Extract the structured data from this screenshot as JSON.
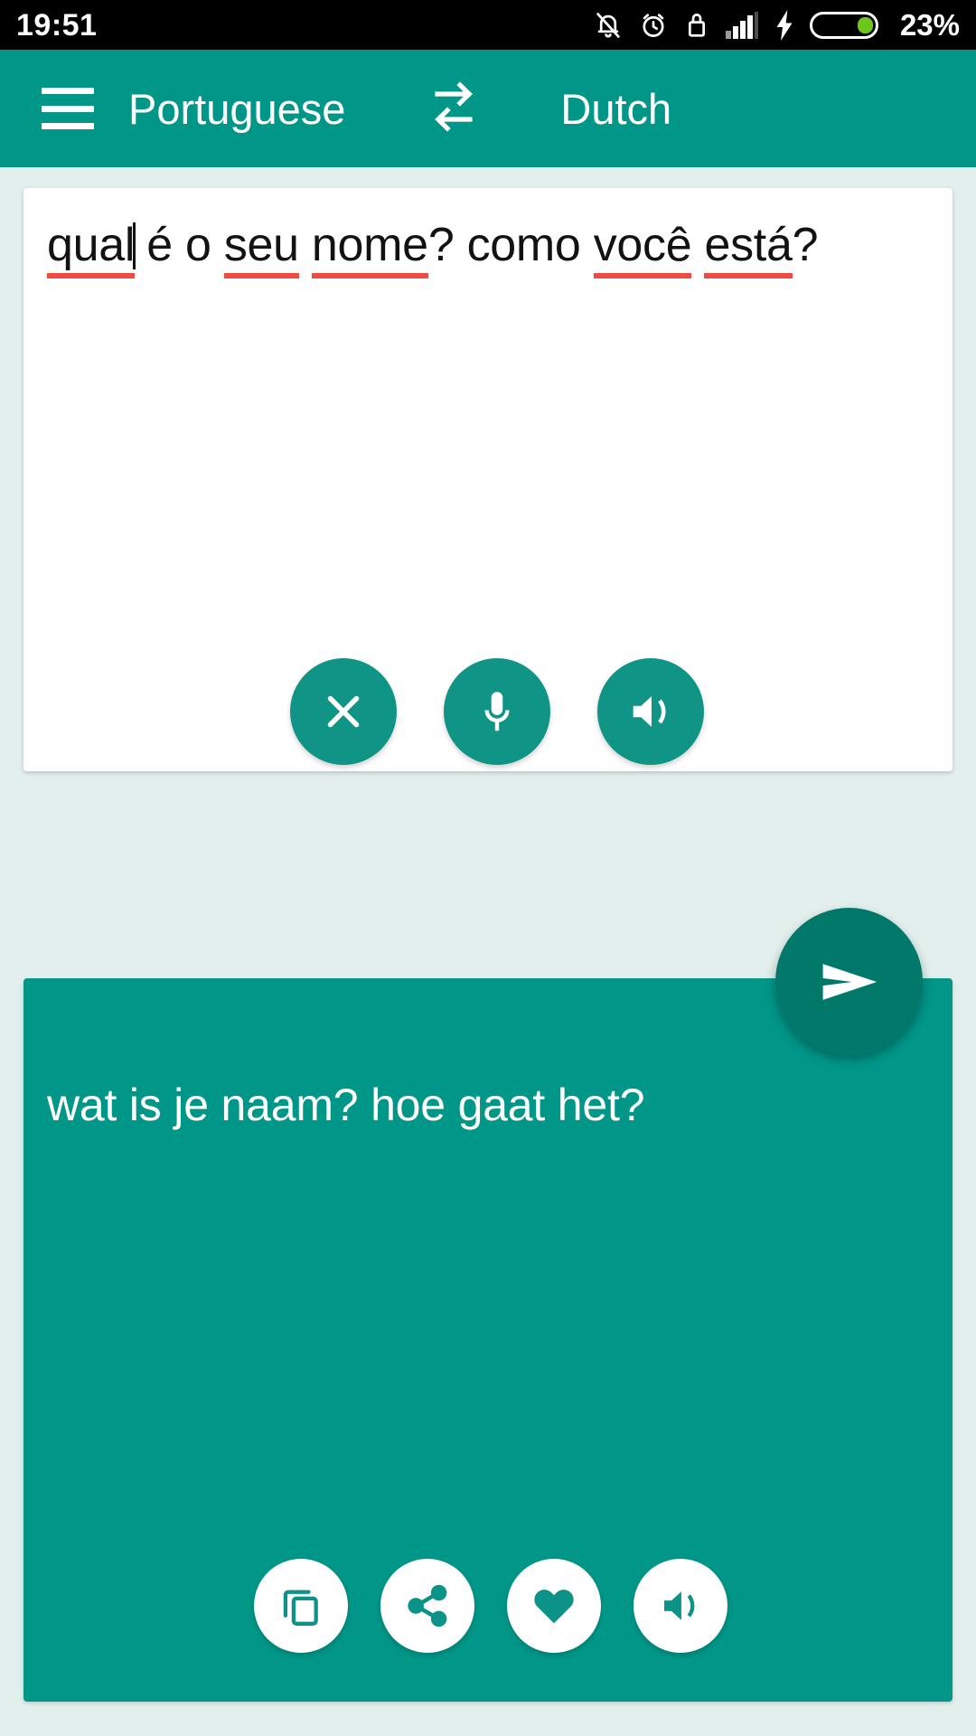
{
  "status_bar": {
    "time": "19:51",
    "battery_percent": "23%",
    "icons": [
      "bell-off-icon",
      "alarm-clock-icon",
      "lock-icon",
      "signal-bars-icon",
      "charging-bolt-icon",
      "battery-icon"
    ]
  },
  "app_bar": {
    "menu_icon": "hamburger-menu-icon",
    "source_language": "Portuguese",
    "swap_icon": "swap-languages-icon",
    "target_language": "Dutch"
  },
  "source_panel": {
    "text": "qual é o seu nome? como você está?",
    "segments": [
      {
        "text": "qual",
        "misspelled": true,
        "caret_after": true
      },
      {
        "text": " é o ",
        "misspelled": false
      },
      {
        "text": "seu",
        "misspelled": true
      },
      {
        "text": " ",
        "misspelled": false
      },
      {
        "text": "nome",
        "misspelled": true
      },
      {
        "text": "? como ",
        "misspelled": false
      },
      {
        "text": "você",
        "misspelled": true
      },
      {
        "text": " ",
        "misspelled": false
      },
      {
        "text": "está",
        "misspelled": true
      },
      {
        "text": "?",
        "misspelled": false
      }
    ],
    "actions": [
      {
        "name": "clear-button",
        "icon": "close-x-icon",
        "label": "Clear"
      },
      {
        "name": "microphone-button",
        "icon": "microphone-icon",
        "label": "Speak"
      },
      {
        "name": "speak-source-button",
        "icon": "speaker-icon",
        "label": "Listen"
      }
    ]
  },
  "send_button": {
    "name": "send-button",
    "icon": "send-icon",
    "label": "Translate"
  },
  "result_panel": {
    "text": "wat is je naam? hoe gaat het?",
    "actions": [
      {
        "name": "copy-button",
        "icon": "copy-icon",
        "label": "Copy"
      },
      {
        "name": "share-button",
        "icon": "share-icon",
        "label": "Share"
      },
      {
        "name": "favorite-button",
        "icon": "heart-icon",
        "label": "Favorite"
      },
      {
        "name": "speak-result-button",
        "icon": "speaker-icon",
        "label": "Listen"
      }
    ]
  },
  "colors": {
    "page_background": "#e2efed",
    "app_bar": "#009688",
    "result_card": "#009688",
    "fab": "#00796b",
    "source_button": "#0f9485",
    "spellcheck_underline": "#f04b41",
    "status_bar": "#000000",
    "battery_fill": "#6ec61a"
  }
}
